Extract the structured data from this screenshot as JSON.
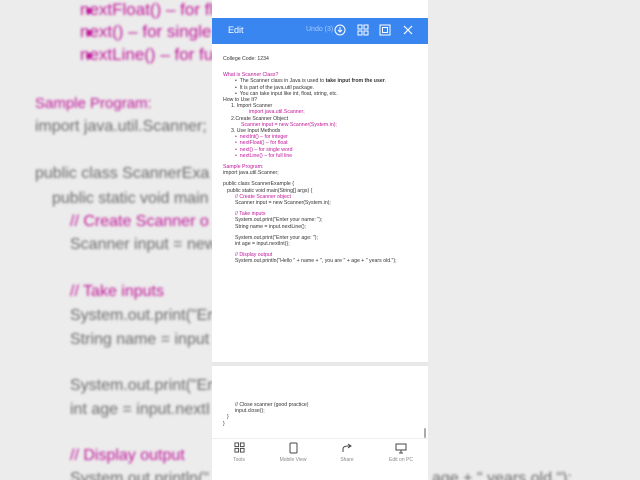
{
  "background": {
    "top_bullets": [
      "nextFloat() – for flo",
      "next() – for single",
      "nextLine() – for fu"
    ],
    "sample_heading": "Sample Program:",
    "import_line": "import java.util.Scanner;",
    "class_line": "public class ScannerExa",
    "main_line": "public static void main",
    "comment_create": "// Create Scanner o",
    "scanner_line": "Scanner input = new",
    "comment_take": "// Take inputs",
    "print_name": "System.out.print(\"En",
    "string_name": "String name = input",
    "print_age": "System.out.print(\"En",
    "int_age": "int age = input.nextI",
    "comment_display": "// Display output",
    "println_line": "System.out.println(\"",
    "right_tail": "age + \" years old.\");"
  },
  "toolbar": {
    "edit_label": "Edit",
    "undo_label": "Undo (3)"
  },
  "doc": {
    "college_code": "College Code: 1234",
    "what_heading": "What is Scanner Class?",
    "bullet1_pre": "The Scanner class in Java is used to ",
    "bullet1_bold": "take input from the user",
    "bullet1_post": ".",
    "bullet2": "It is part of the java.util package.",
    "bullet3": "You can take input like int, float, string, etc.",
    "how_heading": "How to Use It?",
    "step1": "1.   Import Scanner",
    "step1_code": "import java.util.Scanner;",
    "step2": "2.Create Scanner Object",
    "step2_code": "Scanner input = new Scanner(System.in);",
    "step3": "3.   Use Input Methods",
    "methods": [
      "nextInt() – for integer",
      "nextFloat() – for float",
      "next() – for single word",
      "nextLine() – for full line"
    ],
    "sample_heading": "Sample Program:",
    "import_line": "import java.util.Scanner;",
    "class_line": "public class ScannerExample {",
    "main_line": "public static void main(String[] args) {",
    "comment_create": "// Create Scanner object",
    "scanner_line": "Scanner input = new Scanner(System.in);",
    "comment_take": "// Take inputs",
    "print_name": "System.out.print(\"Enter your name: \");",
    "string_name": "String name = input.nextLine();",
    "print_age": "System.out.print(\"Enter your age: \");",
    "int_age": "int age = input.nextInt();",
    "comment_display": "// Display output",
    "println_line": "System.out.println(\"Hello \" + name + \", you are \" + age + \" years old.\");",
    "comment_close": "// Close scanner (good practice)",
    "close_line": "input.close();",
    "brace1": "}",
    "brace2": "}"
  },
  "bottombar": {
    "tools": "Tools",
    "mobile_view": "Mobile View",
    "share": "Share",
    "edit_on_pc": "Edit on PC"
  }
}
